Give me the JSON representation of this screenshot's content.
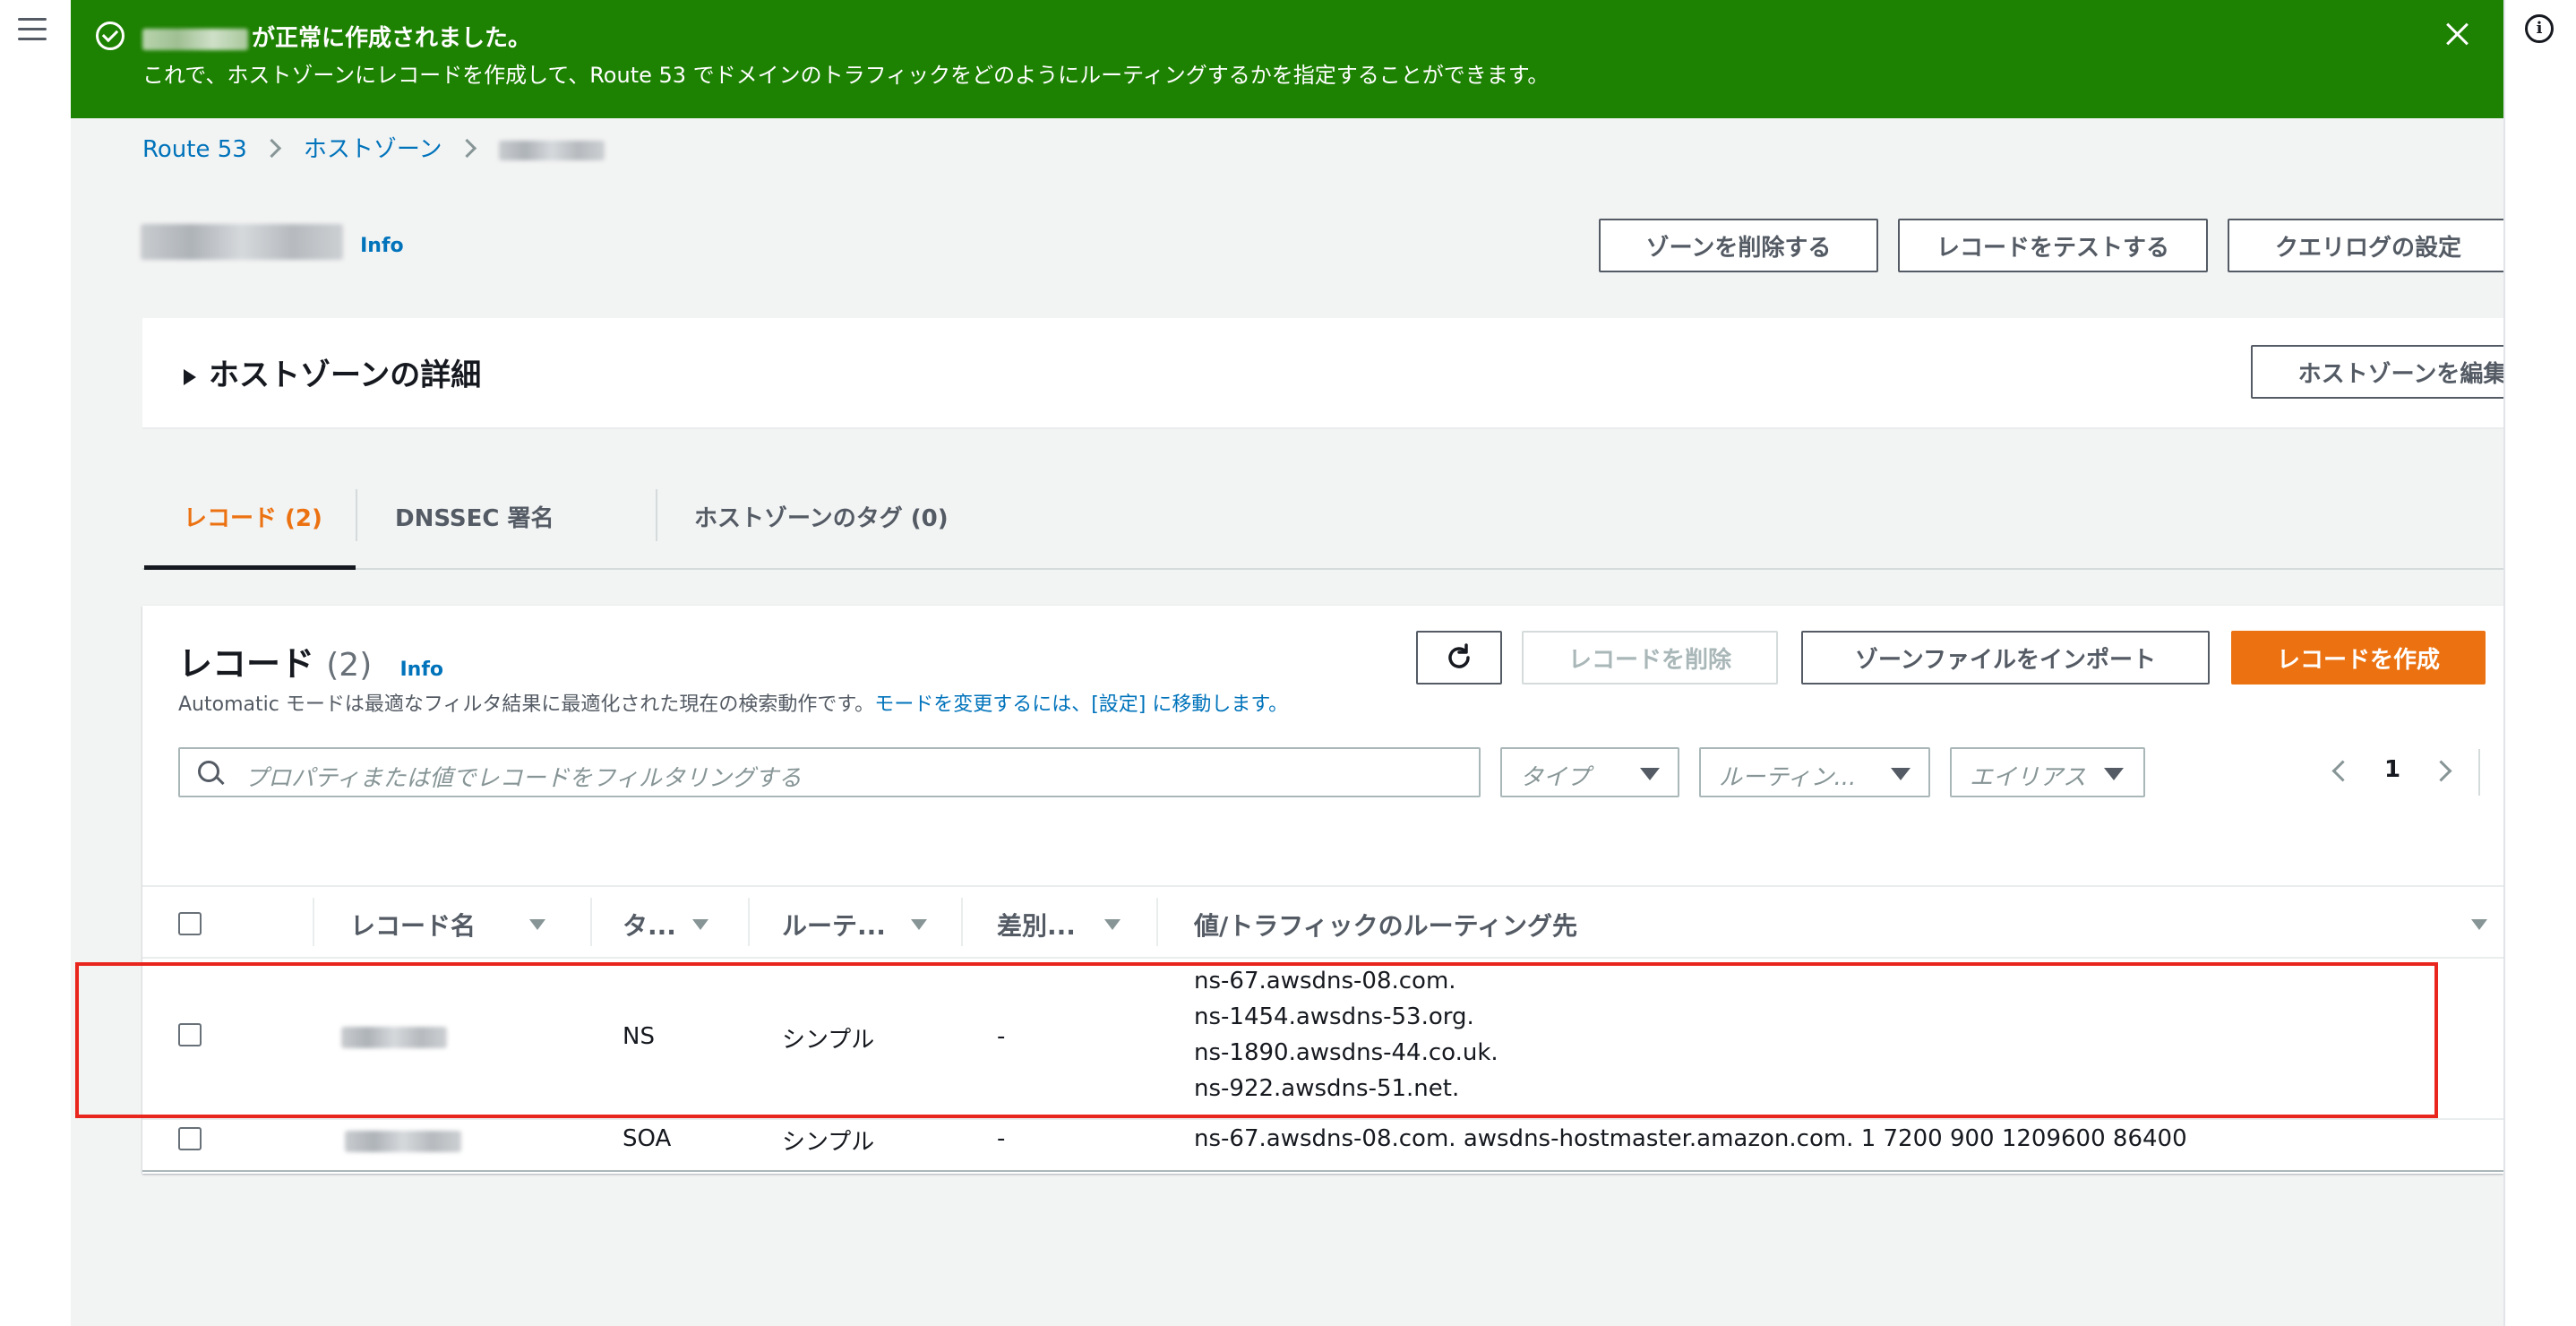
{
  "flash": {
    "title_suffix": "が正常に作成されました。",
    "body": "これで、ホストゾーンにレコードを作成して、Route 53 でドメインのトラフィックをどのようにルーティングするかを指定することができます。"
  },
  "breadcrumb": {
    "root": "Route 53",
    "zones": "ホストゾーン"
  },
  "header": {
    "info": "Info",
    "delete_zone": "ゾーンを削除する",
    "test_record": "レコードをテストする",
    "query_log": "クエリログの設定"
  },
  "details": {
    "title": "ホストゾーンの詳細",
    "edit": "ホストゾーンを編集"
  },
  "tabs": {
    "records": "レコード (2)",
    "dnssec": "DNSSEC 署名",
    "tags": "ホストゾーンのタグ (0)"
  },
  "records": {
    "title": "レコード",
    "count": "(2)",
    "info": "Info",
    "desc_text": "Automatic モードは最適なフィルタ結果に最適化された現在の検索動作です。",
    "desc_link": "モードを変更するには、[設定] に移動します。",
    "delete": "レコードを削除",
    "import": "ゾーンファイルをインポート",
    "create": "レコードを作成",
    "search_placeholder": "プロパティまたは値でレコードをフィルタリングする",
    "filter_type": "タイプ",
    "filter_routing": "ルーティン...",
    "filter_alias": "エイリアス",
    "page": "1"
  },
  "table": {
    "headers": [
      "レコード名",
      "タ...",
      "ルーテ...",
      "差別...",
      "値/トラフィックのルーティング先"
    ],
    "rows": [
      {
        "type": "NS",
        "routing": "シンプル",
        "diff": "-",
        "values": [
          "ns-67.awsdns-08.com.",
          "ns-1454.awsdns-53.org.",
          "ns-1890.awsdns-44.co.uk.",
          "ns-922.awsdns-51.net."
        ]
      },
      {
        "type": "SOA",
        "routing": "シンプル",
        "diff": "-",
        "values": [
          "ns-67.awsdns-08.com. awsdns-hostmaster.amazon.com. 1 7200 900 1209600 86400"
        ]
      }
    ]
  },
  "colors": {
    "success": "#1d8102",
    "link": "#0073bb",
    "primary": "#ec7211",
    "highlight": "#e8261d"
  },
  "icons": [
    "menu-icon",
    "info-icon",
    "check-circle-icon",
    "close-icon",
    "chevron-right-icon",
    "caret-right-icon",
    "refresh-icon",
    "search-icon",
    "caret-down-icon",
    "chevron-left-icon",
    "settings-icon"
  ]
}
